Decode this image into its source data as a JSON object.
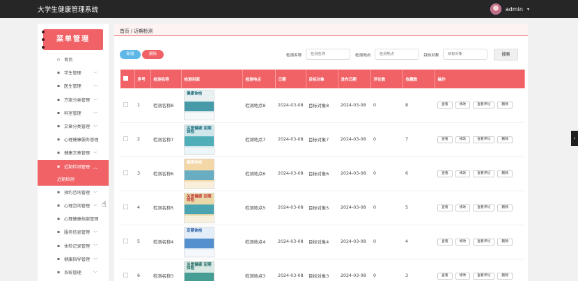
{
  "topbar": {
    "app_title": "大学生健康管理系统",
    "username": "admin",
    "caret": "▾"
  },
  "sidebar": {
    "menu_title": "菜单管理",
    "items": [
      {
        "label": "首页",
        "icon": "⌂",
        "chev": ""
      },
      {
        "label": "学生管理",
        "icon": "▪",
        "chev": "﹀"
      },
      {
        "label": "医生管理",
        "icon": "▪",
        "chev": "﹀"
      },
      {
        "label": "方案分类管理",
        "icon": "▪",
        "chev": "﹀"
      },
      {
        "label": "科室管理",
        "icon": "▪",
        "chev": "﹀"
      },
      {
        "label": "文章分类管理",
        "icon": "▪",
        "chev": "﹀"
      },
      {
        "label": "心理健康服务管理",
        "icon": "▪",
        "chev": ""
      },
      {
        "label": "健康文章管理",
        "icon": "▪",
        "chev": "﹀"
      },
      {
        "label": "近期检测管理",
        "icon": "▪",
        "chev": "︿"
      },
      {
        "label": "预约咨询管理",
        "icon": "▪",
        "chev": "﹀"
      },
      {
        "label": "心理咨询管理",
        "icon": "▪",
        "chev": "﹀"
      },
      {
        "label": "心理健康档案管理",
        "icon": "▪",
        "chev": ""
      },
      {
        "label": "服务信息管理",
        "icon": "▪",
        "chev": "﹀"
      },
      {
        "label": "体检记录管理",
        "icon": "▪",
        "chev": "﹀"
      },
      {
        "label": "健康指导管理",
        "icon": "▪",
        "chev": "﹀"
      },
      {
        "label": "系统管理",
        "icon": "▪",
        "chev": "﹀"
      }
    ],
    "sub_item": "近期检测"
  },
  "breadcrumb": "首页 / 近期检测",
  "toolbar": {
    "add_label": "新增",
    "delete_label": "删除",
    "search_label": "搜索"
  },
  "filters": [
    {
      "label": "检测名称",
      "placeholder": "检测名称"
    },
    {
      "label": "检测地点",
      "placeholder": "检测地点"
    },
    {
      "label": "目标对象",
      "placeholder": "目标对象"
    }
  ],
  "table": {
    "headers": [
      "序号",
      "检测名称",
      "检测封面",
      "检测地点",
      "日期",
      "目标对象",
      "发布日期",
      "评论数",
      "收藏数",
      "操作"
    ],
    "actions": [
      "查看",
      "修改",
      "查看评论",
      "删除"
    ],
    "rows": [
      {
        "no": "1",
        "name": "检测名称8",
        "place": "检测地点8",
        "date": "2024-03-08",
        "target": "目标对象8",
        "pub": "2024-03-08",
        "comments": "0",
        "favs": "8",
        "cover": {
          "title": "健康体检",
          "bg": "#e9f1f3",
          "band": "#2a8c9a",
          "tc": "#1f6b7a"
        }
      },
      {
        "no": "2",
        "name": "检测名称7",
        "place": "检测地点7",
        "date": "2024-03-08",
        "target": "目标对象7",
        "pub": "2024-03-08",
        "comments": "0",
        "favs": "7",
        "cover": {
          "title": "关爱健康 定期体检",
          "bg": "#cfe6ea",
          "band": "#3aa3b0",
          "tc": "#1c6f80"
        }
      },
      {
        "no": "3",
        "name": "检测名称6",
        "place": "检测地点6",
        "date": "2024-03-08",
        "target": "目标对象6",
        "pub": "2024-03-08",
        "comments": "0",
        "favs": "6",
        "cover": {
          "title": "健康体检",
          "bg": "#f3d7a6",
          "band": "#4fa6c6",
          "tc": "#ffffff"
        }
      },
      {
        "no": "4",
        "name": "检测名称5",
        "place": "检测地点5",
        "date": "2024-03-08",
        "target": "目标对象5",
        "pub": "2024-03-08",
        "comments": "0",
        "favs": "5",
        "cover": {
          "title": "关爱健康 定期体检",
          "bg": "#ead9a8",
          "band": "#2e9bb3",
          "tc": "#c23a3a"
        }
      },
      {
        "no": "5",
        "name": "检测名称4",
        "place": "检测地点4",
        "date": "2024-03-08",
        "target": "目标对象4",
        "pub": "2024-03-08",
        "comments": "0",
        "favs": "4",
        "cover": {
          "title": "定期体检",
          "bg": "#e3eef8",
          "band": "#3c7fc7",
          "tc": "#2a5ea8"
        }
      },
      {
        "no": "6",
        "name": "检测名称3",
        "place": "检测地点3",
        "date": "2024-03-08",
        "target": "目标对象3",
        "pub": "2024-03-08",
        "comments": "0",
        "favs": "3",
        "cover": {
          "title": "关爱健康 定期体检",
          "bg": "#d7e9e2",
          "band": "#2c8f86",
          "tc": "#1e6b63"
        }
      }
    ]
  },
  "colors": {
    "accent": "#f06266",
    "topbar": "#262626",
    "add_button": "#5db8e8"
  }
}
